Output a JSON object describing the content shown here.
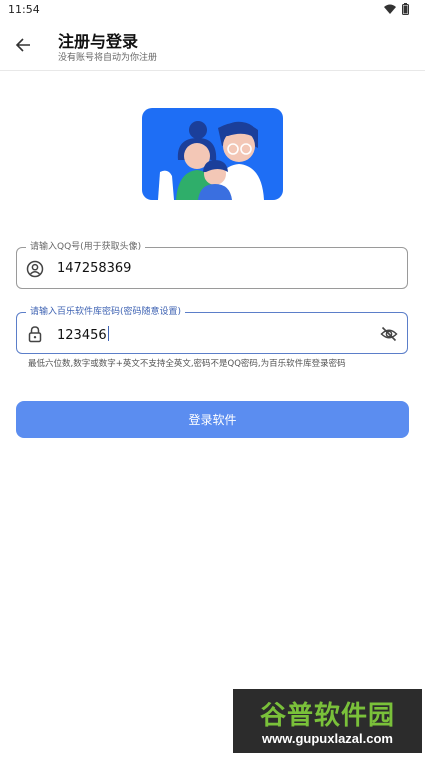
{
  "status_bar": {
    "time": "11:54"
  },
  "app_bar": {
    "title": "注册与登录",
    "subtitle": "没有账号将自动为你注册"
  },
  "qq_field": {
    "label": "请输入QQ号(用于获取头像)",
    "value": "147258369"
  },
  "password_field": {
    "label": "请输入百乐软件库密码(密码随意设置)",
    "value": "123456"
  },
  "hint": "最低六位数,数字或数字+英文不支持全英文,密码不是QQ密码,为百乐软件库登录密码",
  "login_button": {
    "label": "登录软件"
  },
  "watermark": {
    "name": "谷普软件园",
    "url": "www.gupuxlazal.com"
  },
  "colors": {
    "accent": "#5b8df0",
    "illustration_bg": "#1e6ef5"
  }
}
